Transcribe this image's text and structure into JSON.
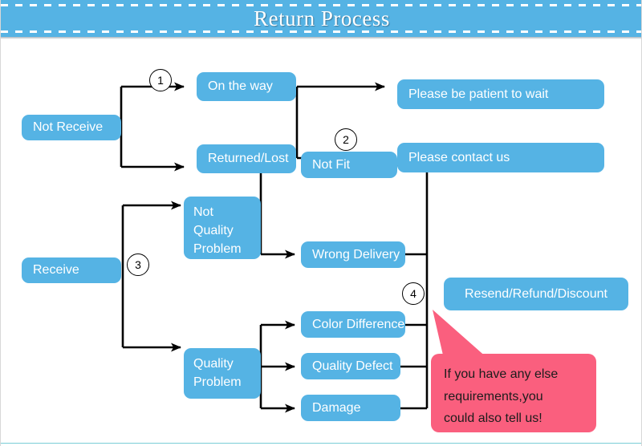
{
  "header": {
    "title": "Return Process"
  },
  "colors": {
    "node_blue": "#55b3e4",
    "banner_blue": "#55b3e4",
    "callout_pink": "#fa5f7e",
    "wire_black": "#000000",
    "footer_rule": "#79cdd6"
  },
  "flow": {
    "nodes": {
      "not_receive": "Not Receive",
      "on_the_way": "On the way",
      "returned_lost": "Returned/Lost",
      "please_wait": "Please be patient to wait",
      "please_contact": "Please contact us",
      "receive": "Receive",
      "not_quality_problem": "Not\nQuality\nProblem",
      "quality_problem": "Quality\nProblem",
      "not_fit": "Not Fit",
      "wrong_delivery": "Wrong Delivery",
      "color_difference": "Color Difference",
      "quality_defect": "Quality Defect",
      "damage": "Damage",
      "resend_refund_discount": "Resend/Refund/Discount"
    },
    "markers": {
      "one": "1",
      "two": "2",
      "three": "3",
      "four": "4"
    }
  },
  "callout": {
    "text": "If you have any else\nrequirements,you\ncould also tell us!"
  }
}
